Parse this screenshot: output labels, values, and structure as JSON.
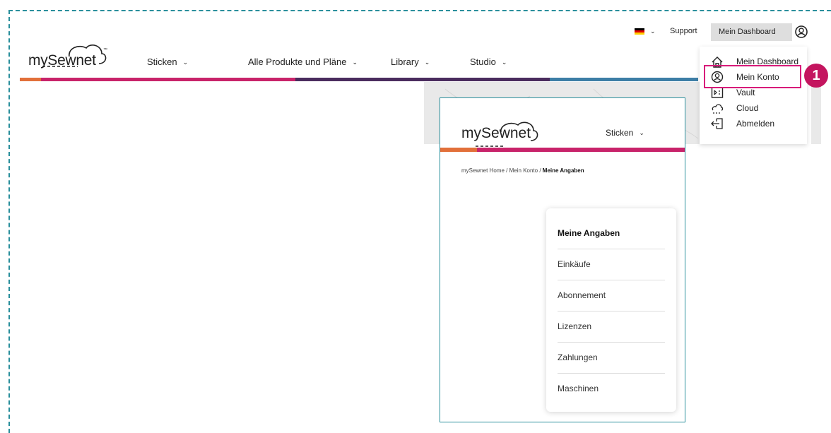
{
  "brand": {
    "logo_text": "mySewnet",
    "trademark": "™"
  },
  "nav": [
    {
      "label": "Sticken"
    },
    {
      "label": "Alle Produkte und Pläne"
    },
    {
      "label": "Library"
    },
    {
      "label": "Studio"
    }
  ],
  "utility": {
    "support_label": "Support",
    "dashboard_label": "Mein Dashboard",
    "language_flag_icon": "flag-de-icon"
  },
  "account_menu": [
    {
      "label": "Mein Dashboard",
      "icon": "house-icon"
    },
    {
      "label": "Mein Konto",
      "icon": "user-circle-icon"
    },
    {
      "label": "Vault",
      "icon": "vault-icon"
    },
    {
      "label": "Cloud",
      "icon": "cloud-icon"
    },
    {
      "label": "Abmelden",
      "icon": "logout-icon"
    }
  ],
  "callout": {
    "number": "1",
    "color": "#c4155f"
  },
  "panel": {
    "logo_text": "mySewnet",
    "nav_label": "Sticken",
    "breadcrumb": {
      "home": "mySewnet Home",
      "sep1": "/",
      "account": "Mein Konto",
      "sep2": "/",
      "current": "Meine Angaben"
    },
    "menu": [
      {
        "label": "Meine Angaben",
        "active": true
      },
      {
        "label": "Einkäufe"
      },
      {
        "label": "Abonnement"
      },
      {
        "label": "Lizenzen"
      },
      {
        "label": "Zahlungen"
      },
      {
        "label": "Maschinen"
      }
    ]
  },
  "colors": {
    "frame": "#2a8f9c",
    "bar_orange": "#e2703a",
    "bar_magenta": "#c8236a",
    "bar_purple": "#4a2c5e",
    "bar_blue": "#3d7ea6",
    "highlight": "#d81b7a"
  }
}
